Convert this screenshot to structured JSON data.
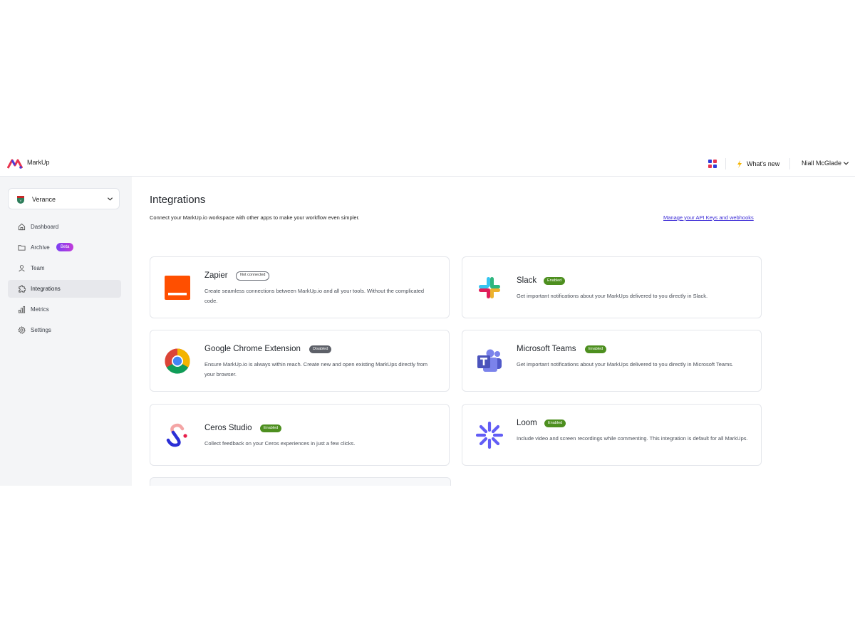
{
  "header": {
    "brand": "MarkUp",
    "whats_new": "What's new",
    "user_name": "Niall McGlade"
  },
  "sidebar": {
    "workspace": "Verance",
    "items": [
      {
        "label": "Dashboard",
        "icon": "home-icon"
      },
      {
        "label": "Archive",
        "icon": "folder-icon",
        "badge": "Beta"
      },
      {
        "label": "Team",
        "icon": "user-icon"
      },
      {
        "label": "Integrations",
        "icon": "puzzle-icon",
        "active": true
      },
      {
        "label": "Metrics",
        "icon": "bar-chart-icon"
      },
      {
        "label": "Settings",
        "icon": "gear-icon"
      }
    ]
  },
  "main": {
    "title": "Integrations",
    "subtitle": "Connect your MarkUp.io workspace with other apps to make your workflow even simpler.",
    "api_link": "Manage your API Keys and webhooks",
    "integrations": [
      {
        "name": "Zapier",
        "status": "Not connected",
        "description": "Create seamless connections between MarkUp.io and all your tools. Without the complicated code.",
        "icon": "zapier-icon"
      },
      {
        "name": "Slack",
        "status": "Enabled",
        "description": "Get important notifications about your MarkUps delivered to you directly in Slack.",
        "icon": "slack-icon"
      },
      {
        "name": "Google Chrome Extension",
        "status": "Disabled",
        "description": "Ensure MarkUp.io is always within reach. Create new and open existing MarkUps directly from your browser.",
        "icon": "chrome-icon"
      },
      {
        "name": "Microsoft Teams",
        "status": "Enabled",
        "description": "Get important notifications about your MarkUps delivered to you directly in Microsoft Teams.",
        "icon": "teams-icon"
      },
      {
        "name": "Ceros Studio",
        "status": "Enabled",
        "description": "Collect feedback on your Ceros experiences in just a few clicks.",
        "icon": "ceros-icon"
      },
      {
        "name": "Loom",
        "status": "Enabled",
        "description": "Include video and screen recordings while commenting. This integration is default for all MarkUps.",
        "icon": "loom-icon"
      }
    ]
  },
  "colors": {
    "accent": "#3b2bd6",
    "enabled": "#4d8f1f",
    "disabled": "#5d6068",
    "sidebar_bg": "#f4f5f7"
  }
}
